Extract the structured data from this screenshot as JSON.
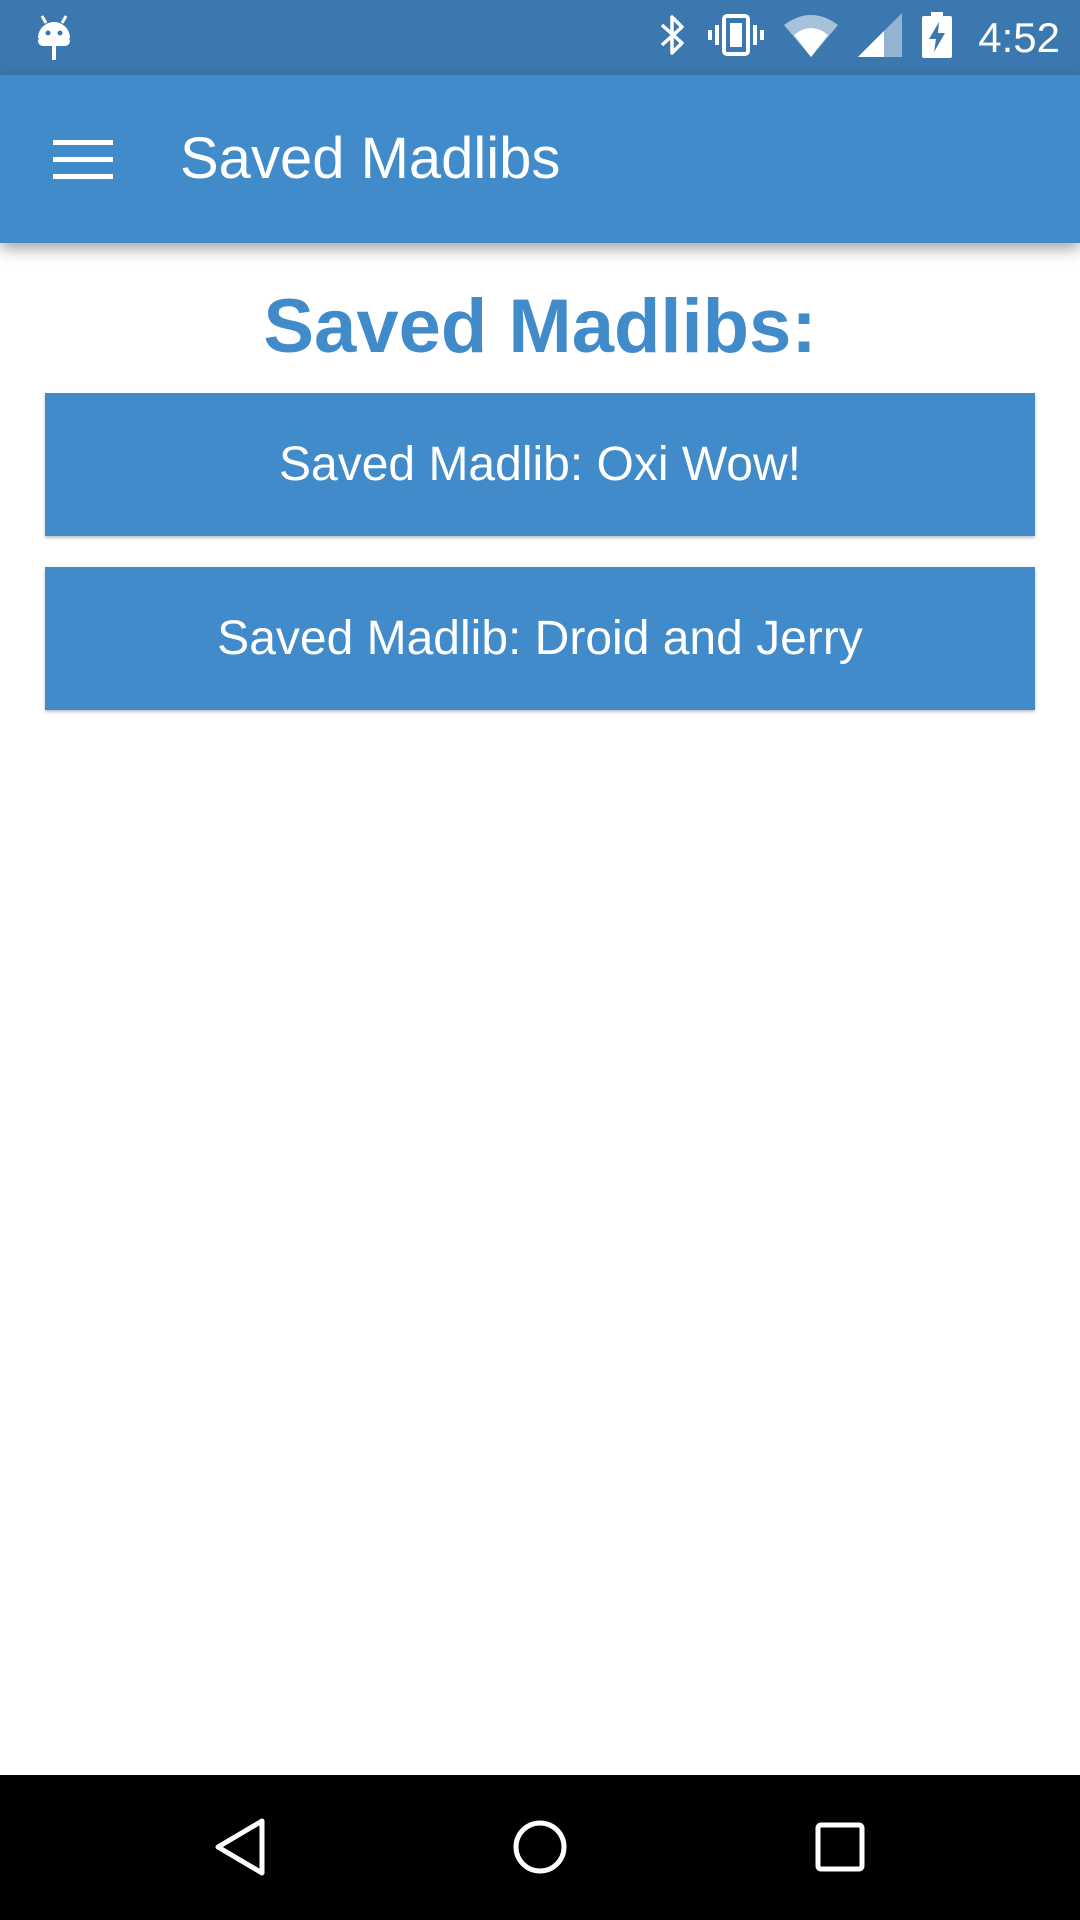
{
  "status_bar": {
    "time": "4:52",
    "icons": [
      "android-debug-icon",
      "bluetooth-icon",
      "vibrate-icon",
      "wifi-icon",
      "cell-signal-icon",
      "battery-charging-icon"
    ]
  },
  "app_bar": {
    "title": "Saved Madlibs",
    "menu_icon": "hamburger-menu-icon"
  },
  "main": {
    "heading": "Saved Madlibs:",
    "saved_items": [
      {
        "label": "Saved Madlib: Oxi Wow!"
      },
      {
        "label": "Saved Madlib: Droid and Jerry"
      }
    ]
  },
  "nav_bar": {
    "icons": [
      "back-icon",
      "home-icon",
      "recents-icon"
    ]
  },
  "colors": {
    "status_bar": "#3b78b0",
    "primary": "#428bca",
    "background": "#ffffff",
    "nav_bar": "#000000"
  }
}
